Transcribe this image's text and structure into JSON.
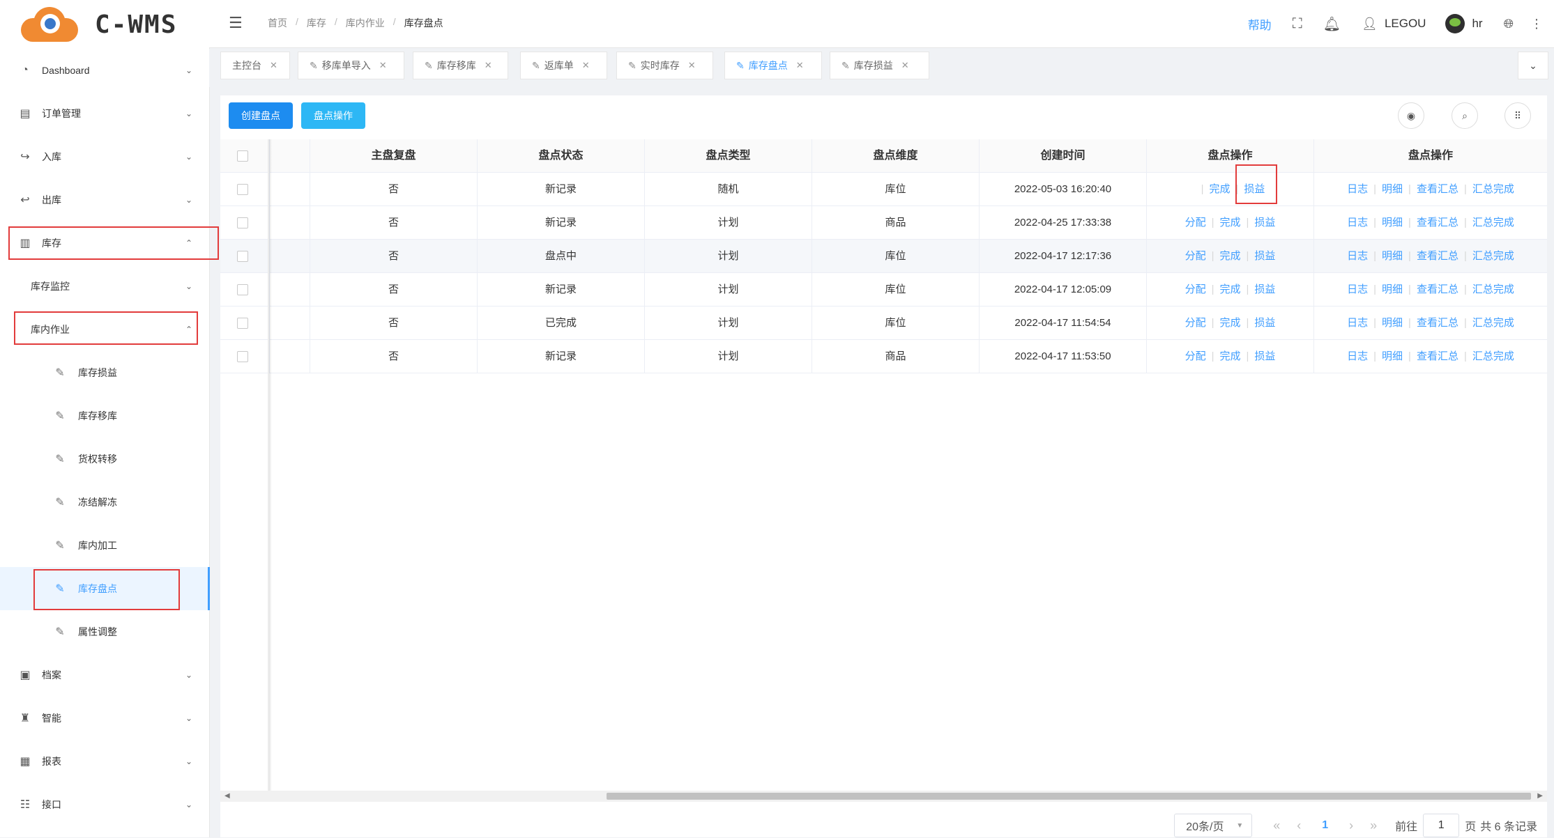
{
  "brand": "C-WMS",
  "sidebar": {
    "items": [
      {
        "label": "Dashboard",
        "icon": "dashboard-icon"
      },
      {
        "label": "订单管理",
        "icon": "order-icon"
      },
      {
        "label": "入库",
        "icon": "inbound-icon"
      },
      {
        "label": "出库",
        "icon": "outbound-icon"
      },
      {
        "label": "库存",
        "icon": "inventory-icon"
      },
      {
        "label": "库存监控"
      },
      {
        "label": "库内作业"
      },
      {
        "label": "库存损益",
        "icon": "edit-icon"
      },
      {
        "label": "库存移库",
        "icon": "edit-icon"
      },
      {
        "label": "货权转移",
        "icon": "edit-icon"
      },
      {
        "label": "冻结解冻",
        "icon": "edit-icon"
      },
      {
        "label": "库内加工",
        "icon": "edit-icon"
      },
      {
        "label": "库存盘点",
        "icon": "edit-icon"
      },
      {
        "label": "属性调整",
        "icon": "edit-icon"
      },
      {
        "label": "档案",
        "icon": "archive-icon"
      },
      {
        "label": "智能",
        "icon": "smart-icon"
      },
      {
        "label": "报表",
        "icon": "report-icon"
      },
      {
        "label": "接口",
        "icon": "interface-icon"
      }
    ]
  },
  "header": {
    "breadcrumbs": [
      "首页",
      "库存",
      "库内作业",
      "库存盘点"
    ],
    "help": "帮助",
    "username": "LEGOU",
    "user2": "hr"
  },
  "tabs": [
    "主控台",
    "移库单导入",
    "库存移库",
    "返库单",
    "实时库存",
    "库存盘点",
    "库存损益"
  ],
  "toolbar": {
    "create": "创建盘点",
    "ops": "盘点操作"
  },
  "table": {
    "headers": [
      "主盘复盘",
      "盘点状态",
      "盘点类型",
      "盘点维度",
      "创建时间",
      "盘点操作",
      "盘点操作"
    ],
    "op1": [
      "分配",
      "完成",
      "损益"
    ],
    "op2": [
      "日志",
      "明细",
      "查看汇总",
      "汇总完成"
    ],
    "rows": [
      {
        "main": "否",
        "status": "新记录",
        "type": "随机",
        "dim": "库位",
        "time": "2022-05-03 16:20:40"
      },
      {
        "main": "否",
        "status": "新记录",
        "type": "计划",
        "dim": "商品",
        "time": "2022-04-25 17:33:38"
      },
      {
        "main": "否",
        "status": "盘点中",
        "type": "计划",
        "dim": "库位",
        "time": "2022-04-17 12:17:36"
      },
      {
        "main": "否",
        "status": "新记录",
        "type": "计划",
        "dim": "库位",
        "time": "2022-04-17 12:05:09"
      },
      {
        "main": "否",
        "status": "已完成",
        "type": "计划",
        "dim": "库位",
        "time": "2022-04-17 11:54:54"
      },
      {
        "main": "否",
        "status": "新记录",
        "type": "计划",
        "dim": "商品",
        "time": "2022-04-17 11:53:50"
      }
    ]
  },
  "pager": {
    "size": "20条/页",
    "current": "1",
    "goto_label": "前往",
    "goto_value": "1",
    "page_suffix": "页",
    "total": "共 6 条记录"
  },
  "colors": {
    "accent": "#409eff",
    "primary_button": "#1d8cf0",
    "secondary_button": "#2db7f5",
    "highlight": "#e23b3b"
  }
}
